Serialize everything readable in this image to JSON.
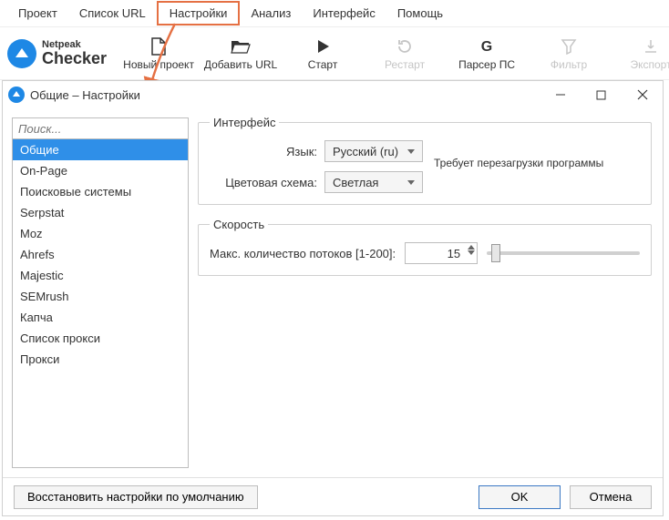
{
  "menu": {
    "items": [
      "Проект",
      "Список URL",
      "Настройки",
      "Анализ",
      "Интерфейс",
      "Помощь"
    ],
    "highlighted_index": 2
  },
  "brand": {
    "line1": "Netpeak",
    "line2": "Checker"
  },
  "toolbar": {
    "items": [
      {
        "label": "Новый проект",
        "icon": "file-icon",
        "disabled": false
      },
      {
        "label": "Добавить URL",
        "icon": "folder-open-icon",
        "disabled": false
      },
      {
        "label": "Старт",
        "icon": "play-icon",
        "disabled": false
      },
      {
        "label": "Рестарт",
        "icon": "refresh-icon",
        "disabled": true
      },
      {
        "label": "Парсер ПС",
        "icon": "g-icon",
        "disabled": false
      },
      {
        "label": "Фильтр",
        "icon": "funnel-icon",
        "disabled": true
      },
      {
        "label": "Экспорт",
        "icon": "export-icon",
        "disabled": true
      }
    ]
  },
  "dialog": {
    "title": "Общие – Настройки",
    "search_placeholder": "Поиск...",
    "sidebar_items": [
      "Общие",
      "On-Page",
      "Поисковые системы",
      "Serpstat",
      "Moz",
      "Ahrefs",
      "Majestic",
      "SEMrush",
      "Капча",
      "Список прокси",
      "Прокси"
    ],
    "selected_index": 0,
    "groups": {
      "interface": {
        "legend": "Интерфейс",
        "language_label": "Язык:",
        "language_value": "Русский (ru)",
        "scheme_label": "Цветовая схема:",
        "scheme_value": "Светлая",
        "restart_note": "Требует перезагрузки программы"
      },
      "speed": {
        "legend": "Скорость",
        "threads_label": "Макс. количество потоков [1-200]:",
        "threads_value": "15"
      }
    },
    "footer": {
      "reset": "Восстановить настройки по умолчанию",
      "ok": "OK",
      "cancel": "Отмена"
    }
  }
}
